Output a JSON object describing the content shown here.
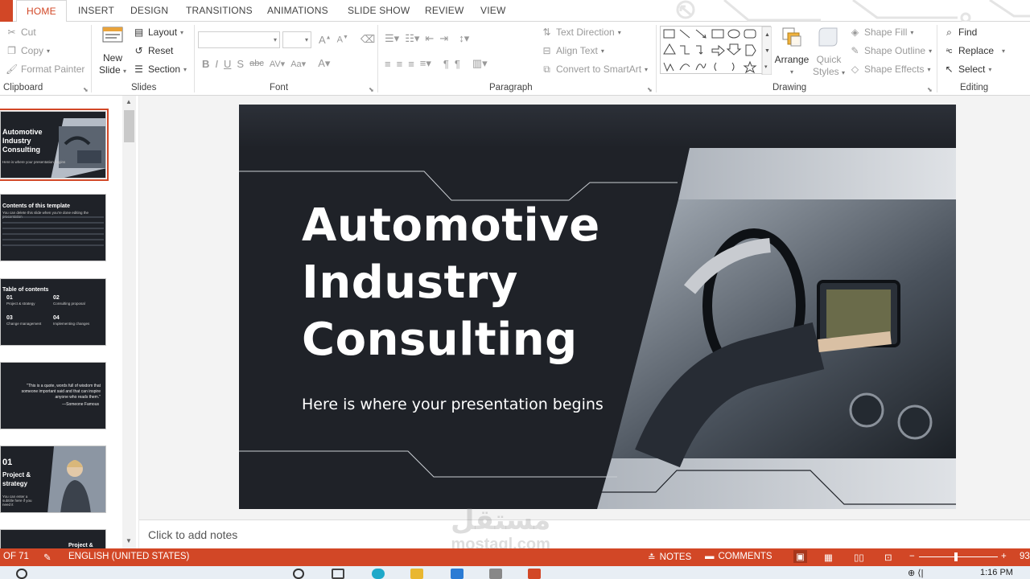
{
  "tabs": [
    "HOME",
    "INSERT",
    "DESIGN",
    "TRANSITIONS",
    "ANIMATIONS",
    "SLIDE SHOW",
    "REVIEW",
    "VIEW"
  ],
  "clipboard": {
    "cut": "Cut",
    "copy": "Copy",
    "format_painter": "Format Painter",
    "label": "Clipboard"
  },
  "slides_group": {
    "new_slide": "New",
    "new_slide2": "Slide",
    "layout": "Layout",
    "reset": "Reset",
    "section": "Section",
    "label": "Slides"
  },
  "font": {
    "label": "Font"
  },
  "paragraph": {
    "text_direction": "Text Direction",
    "align_text": "Align Text",
    "convert": "Convert to SmartArt",
    "label": "Paragraph"
  },
  "drawing": {
    "arrange": "Arrange",
    "quick": "Quick",
    "styles": "Styles",
    "shape_fill": "Shape Fill",
    "shape_outline": "Shape Outline",
    "shape_effects": "Shape Effects",
    "label": "Drawing"
  },
  "editing": {
    "find": "Find",
    "replace": "Replace",
    "select": "Select",
    "label": "Editing"
  },
  "thumbnails": [
    {
      "title": "Automotive Industry Consulting",
      "sub": "Here is where your presentation begins"
    },
    {
      "title": "Contents of this template",
      "sub": "You can delete this slide when you're done editing the presentation"
    },
    {
      "title": "Table of contents",
      "n1": "01",
      "i1": "Project & strategy",
      "n2": "02",
      "i2": "Consulting proposal",
      "n3": "03",
      "i3": "Change management",
      "n4": "04",
      "i4": "Implementing changes"
    },
    {
      "quote": "\"This is a quote, words full of wisdom that someone important said and that can inspire anyone who reads them.\"",
      "author": "—Someone Famous"
    },
    {
      "num": "01",
      "title": "Project & strategy",
      "sub": "You can enter a subtitle here if you need it"
    },
    {
      "title": "Project &"
    }
  ],
  "slide": {
    "title_l1": "Automotive",
    "title_l2": "Industry",
    "title_l3": "Consulting",
    "subtitle": "Here is where your presentation begins"
  },
  "notes": {
    "placeholder": "Click to add notes"
  },
  "status": {
    "slide_of": "OF 71",
    "language": "ENGLISH (UNITED STATES)",
    "notes": "NOTES",
    "comments": "COMMENTS",
    "zoom": "93"
  },
  "taskbar": {
    "time": "1:16 PM"
  },
  "watermark": {
    "arabic": "مستقل",
    "latin": "mostaql.com"
  },
  "colors": {
    "accent": "#d24726",
    "slide_dark": "#1f2228"
  }
}
